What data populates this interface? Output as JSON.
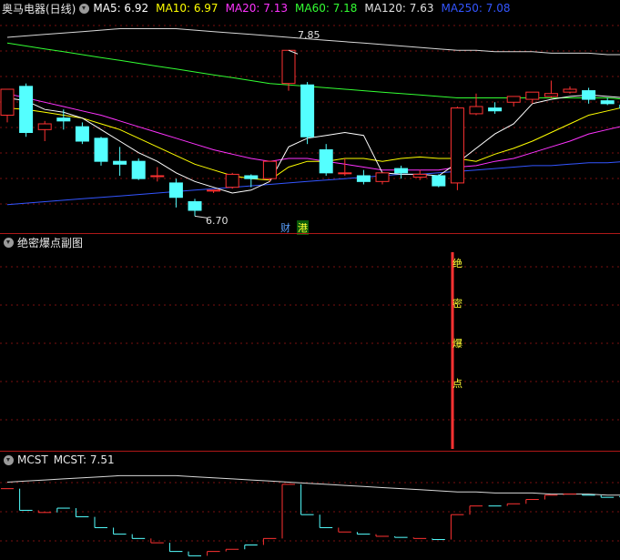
{
  "main": {
    "stock_title": "奥马电器(日线)",
    "ma": [
      {
        "label": "MA5: 6.92",
        "color": "#ffffff"
      },
      {
        "label": "MA10: 6.97",
        "color": "#ffff00"
      },
      {
        "label": "MA20: 7.13",
        "color": "#ff33ff"
      },
      {
        "label": "MA60: 7.18",
        "color": "#33ff33"
      },
      {
        "label": "MA120: 7.63",
        "color": "#e0e0e0"
      },
      {
        "label": "MA250: 7.08",
        "color": "#3355ff"
      }
    ],
    "high_label": "7.85",
    "low_label": "6.70",
    "tag_cai": "财",
    "tag_gang": "港",
    "colors": {
      "up": "#ff3232",
      "down": "#54ffff",
      "ma5": "#ffffff",
      "ma10": "#ffff00",
      "ma20": "#ff33ff",
      "ma60": "#33ff33",
      "ma120": "#d8d8d8",
      "ma250": "#3355ff"
    }
  },
  "sub1": {
    "title": "绝密爆点副图",
    "signal_chars": [
      "绝",
      "密",
      "爆",
      "点"
    ]
  },
  "sub2": {
    "title": "MCST",
    "value_label": "MCST: 7.51"
  },
  "chart_data": {
    "type": "candlestick",
    "candles": [
      {
        "o": 7.4,
        "h": 7.52,
        "c": 7.58,
        "l": 7.35
      },
      {
        "o": 7.6,
        "h": 7.62,
        "c": 7.28,
        "l": 7.25
      },
      {
        "o": 7.3,
        "h": 7.36,
        "c": 7.34,
        "l": 7.22
      },
      {
        "o": 7.38,
        "h": 7.44,
        "c": 7.36,
        "l": 7.3
      },
      {
        "o": 7.32,
        "h": 7.35,
        "c": 7.22,
        "l": 7.2
      },
      {
        "o": 7.24,
        "h": 7.25,
        "c": 7.08,
        "l": 7.05
      },
      {
        "o": 7.08,
        "h": 7.18,
        "c": 7.06,
        "l": 6.98
      },
      {
        "o": 7.08,
        "h": 7.1,
        "c": 6.96,
        "l": 6.95
      },
      {
        "o": 6.98,
        "h": 7.04,
        "c": 6.98,
        "l": 6.94
      },
      {
        "o": 6.93,
        "h": 6.96,
        "c": 6.83,
        "l": 6.76
      },
      {
        "o": 6.8,
        "h": 6.82,
        "c": 6.74,
        "l": 6.7
      },
      {
        "o": 6.88,
        "h": 6.88,
        "c": 6.88,
        "l": 6.86
      },
      {
        "o": 6.9,
        "h": 7.0,
        "c": 6.99,
        "l": 6.89
      },
      {
        "o": 6.98,
        "h": 6.99,
        "c": 6.96,
        "l": 6.9
      },
      {
        "o": 6.96,
        "h": 7.08,
        "c": 7.08,
        "l": 6.94
      },
      {
        "o": 7.62,
        "h": 7.85,
        "c": 7.85,
        "l": 7.57
      },
      {
        "o": 7.61,
        "h": 7.63,
        "c": 7.25,
        "l": 7.2
      },
      {
        "o": 7.16,
        "h": 7.2,
        "c": 7.0,
        "l": 6.98
      },
      {
        "o": 7.0,
        "h": 7.1,
        "c": 7.0,
        "l": 6.98
      },
      {
        "o": 6.98,
        "h": 7.02,
        "c": 6.94,
        "l": 6.92
      },
      {
        "o": 6.94,
        "h": 7.0,
        "c": 7.0,
        "l": 6.92
      },
      {
        "o": 7.03,
        "h": 7.05,
        "c": 7.0,
        "l": 6.96
      },
      {
        "o": 6.97,
        "h": 7.02,
        "c": 6.99,
        "l": 6.95
      },
      {
        "o": 6.98,
        "h": 6.99,
        "c": 6.91,
        "l": 6.9
      },
      {
        "o": 6.93,
        "h": 7.46,
        "c": 7.45,
        "l": 6.88
      },
      {
        "o": 7.41,
        "h": 7.55,
        "c": 7.46,
        "l": 7.4
      },
      {
        "o": 7.45,
        "h": 7.49,
        "c": 7.43,
        "l": 7.41
      },
      {
        "o": 7.49,
        "h": 7.53,
        "c": 7.53,
        "l": 7.46
      },
      {
        "o": 7.51,
        "h": 7.56,
        "c": 7.56,
        "l": 7.48
      },
      {
        "o": 7.53,
        "h": 7.64,
        "c": 7.55,
        "l": 7.52
      },
      {
        "o": 7.56,
        "h": 7.6,
        "c": 7.58,
        "l": 7.55
      },
      {
        "o": 7.57,
        "h": 7.59,
        "c": 7.51,
        "l": 7.48
      },
      {
        "o": 7.5,
        "h": 7.52,
        "c": 7.48,
        "l": 7.47
      },
      {
        "o": 7.47,
        "h": 7.5,
        "c": 7.45,
        "l": 7.42
      }
    ],
    "ma5": [
      7.52,
      7.5,
      7.44,
      7.42,
      7.38,
      7.3,
      7.22,
      7.14,
      7.08,
      7.0,
      6.94,
      6.9,
      6.86,
      6.88,
      6.94,
      7.18,
      7.24,
      7.26,
      7.28,
      7.26,
      7.0,
      6.99,
      6.99,
      6.98,
      7.07,
      7.17,
      7.27,
      7.34,
      7.48,
      7.51,
      7.53,
      7.54,
      7.53,
      7.52
    ],
    "ma10": [
      7.45,
      7.44,
      7.42,
      7.4,
      7.38,
      7.34,
      7.3,
      7.24,
      7.18,
      7.12,
      7.06,
      7.02,
      6.98,
      6.96,
      6.95,
      7.04,
      7.08,
      7.08,
      7.1,
      7.1,
      7.08,
      7.1,
      7.11,
      7.1,
      7.1,
      7.08,
      7.13,
      7.17,
      7.22,
      7.28,
      7.34,
      7.4,
      7.43,
      7.46
    ],
    "ma20": [
      7.55,
      7.52,
      7.49,
      7.46,
      7.43,
      7.4,
      7.36,
      7.32,
      7.28,
      7.24,
      7.2,
      7.16,
      7.13,
      7.1,
      7.08,
      7.1,
      7.1,
      7.08,
      7.06,
      7.04,
      7.02,
      7.02,
      7.02,
      7.02,
      7.04,
      7.05,
      7.08,
      7.1,
      7.14,
      7.18,
      7.22,
      7.27,
      7.3,
      7.33
    ],
    "ma60": [
      7.9,
      7.88,
      7.86,
      7.84,
      7.82,
      7.8,
      7.78,
      7.76,
      7.74,
      7.72,
      7.7,
      7.68,
      7.66,
      7.64,
      7.62,
      7.61,
      7.6,
      7.59,
      7.58,
      7.57,
      7.56,
      7.55,
      7.54,
      7.53,
      7.52,
      7.52,
      7.52,
      7.52,
      7.52,
      7.52,
      7.52,
      7.52,
      7.52,
      7.51
    ],
    "ma120": [
      7.94,
      7.95,
      7.96,
      7.97,
      7.98,
      7.99,
      8.0,
      8.0,
      8.0,
      8.0,
      7.99,
      7.98,
      7.97,
      7.96,
      7.95,
      7.94,
      7.93,
      7.92,
      7.91,
      7.9,
      7.89,
      7.88,
      7.87,
      7.86,
      7.85,
      7.85,
      7.84,
      7.84,
      7.84,
      7.83,
      7.83,
      7.83,
      7.82,
      7.82
    ],
    "ma250": [
      6.78,
      6.79,
      6.8,
      6.81,
      6.82,
      6.83,
      6.84,
      6.85,
      6.86,
      6.87,
      6.88,
      6.89,
      6.9,
      6.91,
      6.92,
      6.93,
      6.94,
      6.95,
      6.96,
      6.97,
      6.98,
      6.99,
      6.99,
      7.0,
      7.01,
      7.02,
      7.03,
      7.04,
      7.05,
      7.05,
      7.06,
      7.07,
      7.07,
      7.08
    ],
    "mcst": [
      7.58,
      7.38,
      7.36,
      7.4,
      7.32,
      7.22,
      7.16,
      7.12,
      7.08,
      7.0,
      6.96,
      7.0,
      7.02,
      7.06,
      7.12,
      7.62,
      7.34,
      7.22,
      7.18,
      7.16,
      7.14,
      7.13,
      7.12,
      7.11,
      7.34,
      7.42,
      7.42,
      7.44,
      7.48,
      7.52,
      7.53,
      7.52,
      7.5,
      7.51
    ],
    "ymin": 6.62,
    "ymax": 8.06,
    "mcst_min": 6.98,
    "mcst_max": 7.72
  }
}
